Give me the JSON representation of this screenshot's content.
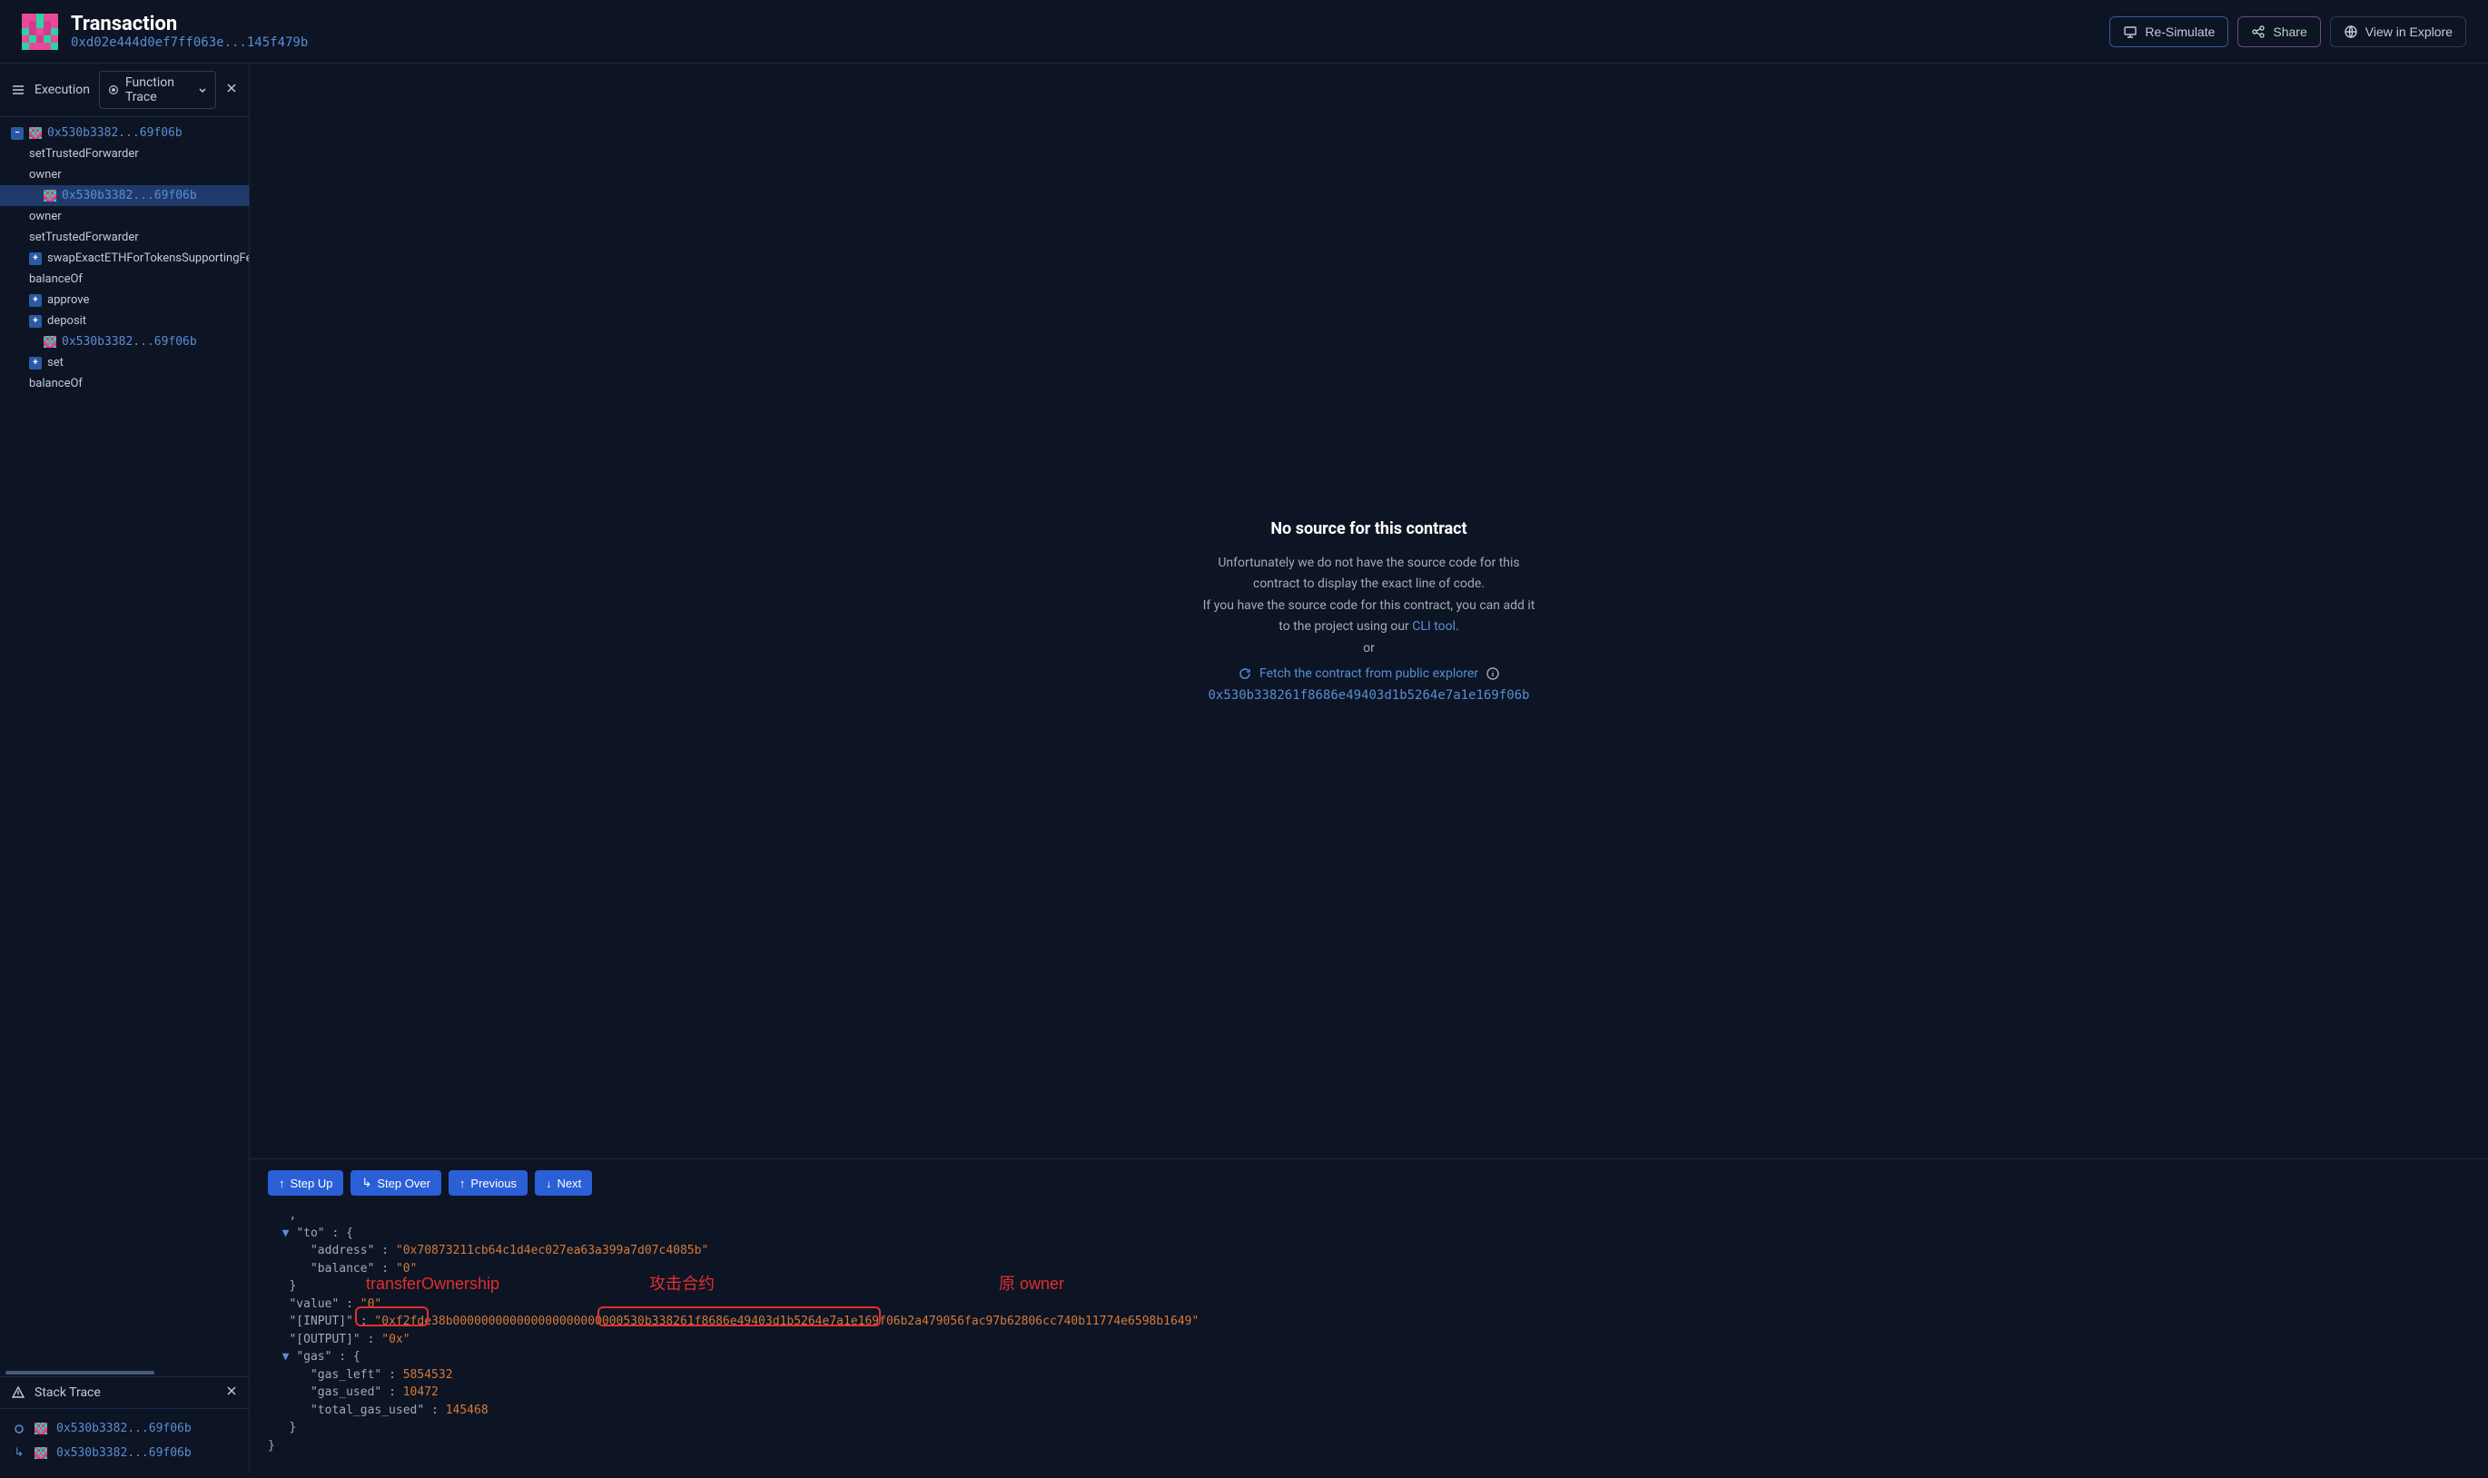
{
  "header": {
    "title": "Transaction",
    "hash": "0xd02e444d0ef7ff063e...145f479b",
    "resimulate": "Re-Simulate",
    "share": "Share",
    "view_explorer": "View in Explore"
  },
  "exec_panel": {
    "title": "Execution",
    "dropdown": "Function Trace"
  },
  "tree": [
    {
      "type": "root",
      "expand": "−",
      "icon": true,
      "text": "0x530b3382...69f06b",
      "addr": true,
      "indent": 0
    },
    {
      "type": "fn",
      "text": "setTrustedForwarder",
      "indent": 1
    },
    {
      "type": "fn",
      "text": "owner",
      "indent": 1
    },
    {
      "type": "addr",
      "icon": true,
      "text": "0x530b3382...69f06b",
      "addr": true,
      "indent": 2,
      "selected": true
    },
    {
      "type": "fn",
      "text": "owner",
      "indent": 1
    },
    {
      "type": "fn",
      "text": "setTrustedForwarder",
      "indent": 1
    },
    {
      "type": "fn",
      "expand": "+",
      "text": "swapExactETHForTokensSupportingFe",
      "indent": 1,
      "expandable": true
    },
    {
      "type": "fn",
      "text": "balanceOf",
      "indent": 1
    },
    {
      "type": "fn",
      "expand": "+",
      "text": "approve",
      "indent": 1,
      "expandable": true
    },
    {
      "type": "fn",
      "expand": "+",
      "text": "deposit",
      "indent": 1,
      "expandable": true
    },
    {
      "type": "addr",
      "icon": true,
      "text": "0x530b3382...69f06b",
      "addr": true,
      "indent": 2
    },
    {
      "type": "fn",
      "expand": "+",
      "text": "set",
      "indent": 1,
      "expandable": true
    },
    {
      "type": "fn",
      "text": "balanceOf",
      "indent": 1
    }
  ],
  "stack_panel": {
    "title": "Stack Trace",
    "items": [
      {
        "marker": "circle",
        "text": "0x530b3382...69f06b"
      },
      {
        "marker": "arrow",
        "text": "0x530b3382...69f06b"
      }
    ]
  },
  "no_source": {
    "title": "No source for this contract",
    "line1": "Unfortunately we do not have the source code for this",
    "line2": "contract to display the exact line of code.",
    "line3a": "If you have the source code for this contract, you can add it",
    "line3b": "to the project using our ",
    "cli_link": "CLI tool",
    "line3c": ".",
    "or": "or",
    "fetch": "Fetch the contract from public explorer",
    "address": "0x530b338261f8686e49403d1b5264e7a1e169f06b"
  },
  "debug": {
    "step_up": "Step Up",
    "step_over": "Step Over",
    "previous": "Previous",
    "next": "Next"
  },
  "json": {
    "to_address": "0x70873211cb64c1d4ec027ea63a399a7d07c4085b",
    "to_balance": "0",
    "value": "0",
    "input_hex": "0xf2fde38b",
    "input_mid": "000000000000000000000000",
    "input_addr": "530b338261f8686e49403d1b5264e7a1e169f06b",
    "input_tail": "2a479056fac97b62806cc740b11774e6598b1649",
    "output": "0x",
    "gas_left": "5854532",
    "gas_used": "10472",
    "total_gas_used": "145468"
  },
  "annotations": {
    "a1": "transferOwnership",
    "a2": "攻击合约",
    "a3": "原 owner"
  }
}
